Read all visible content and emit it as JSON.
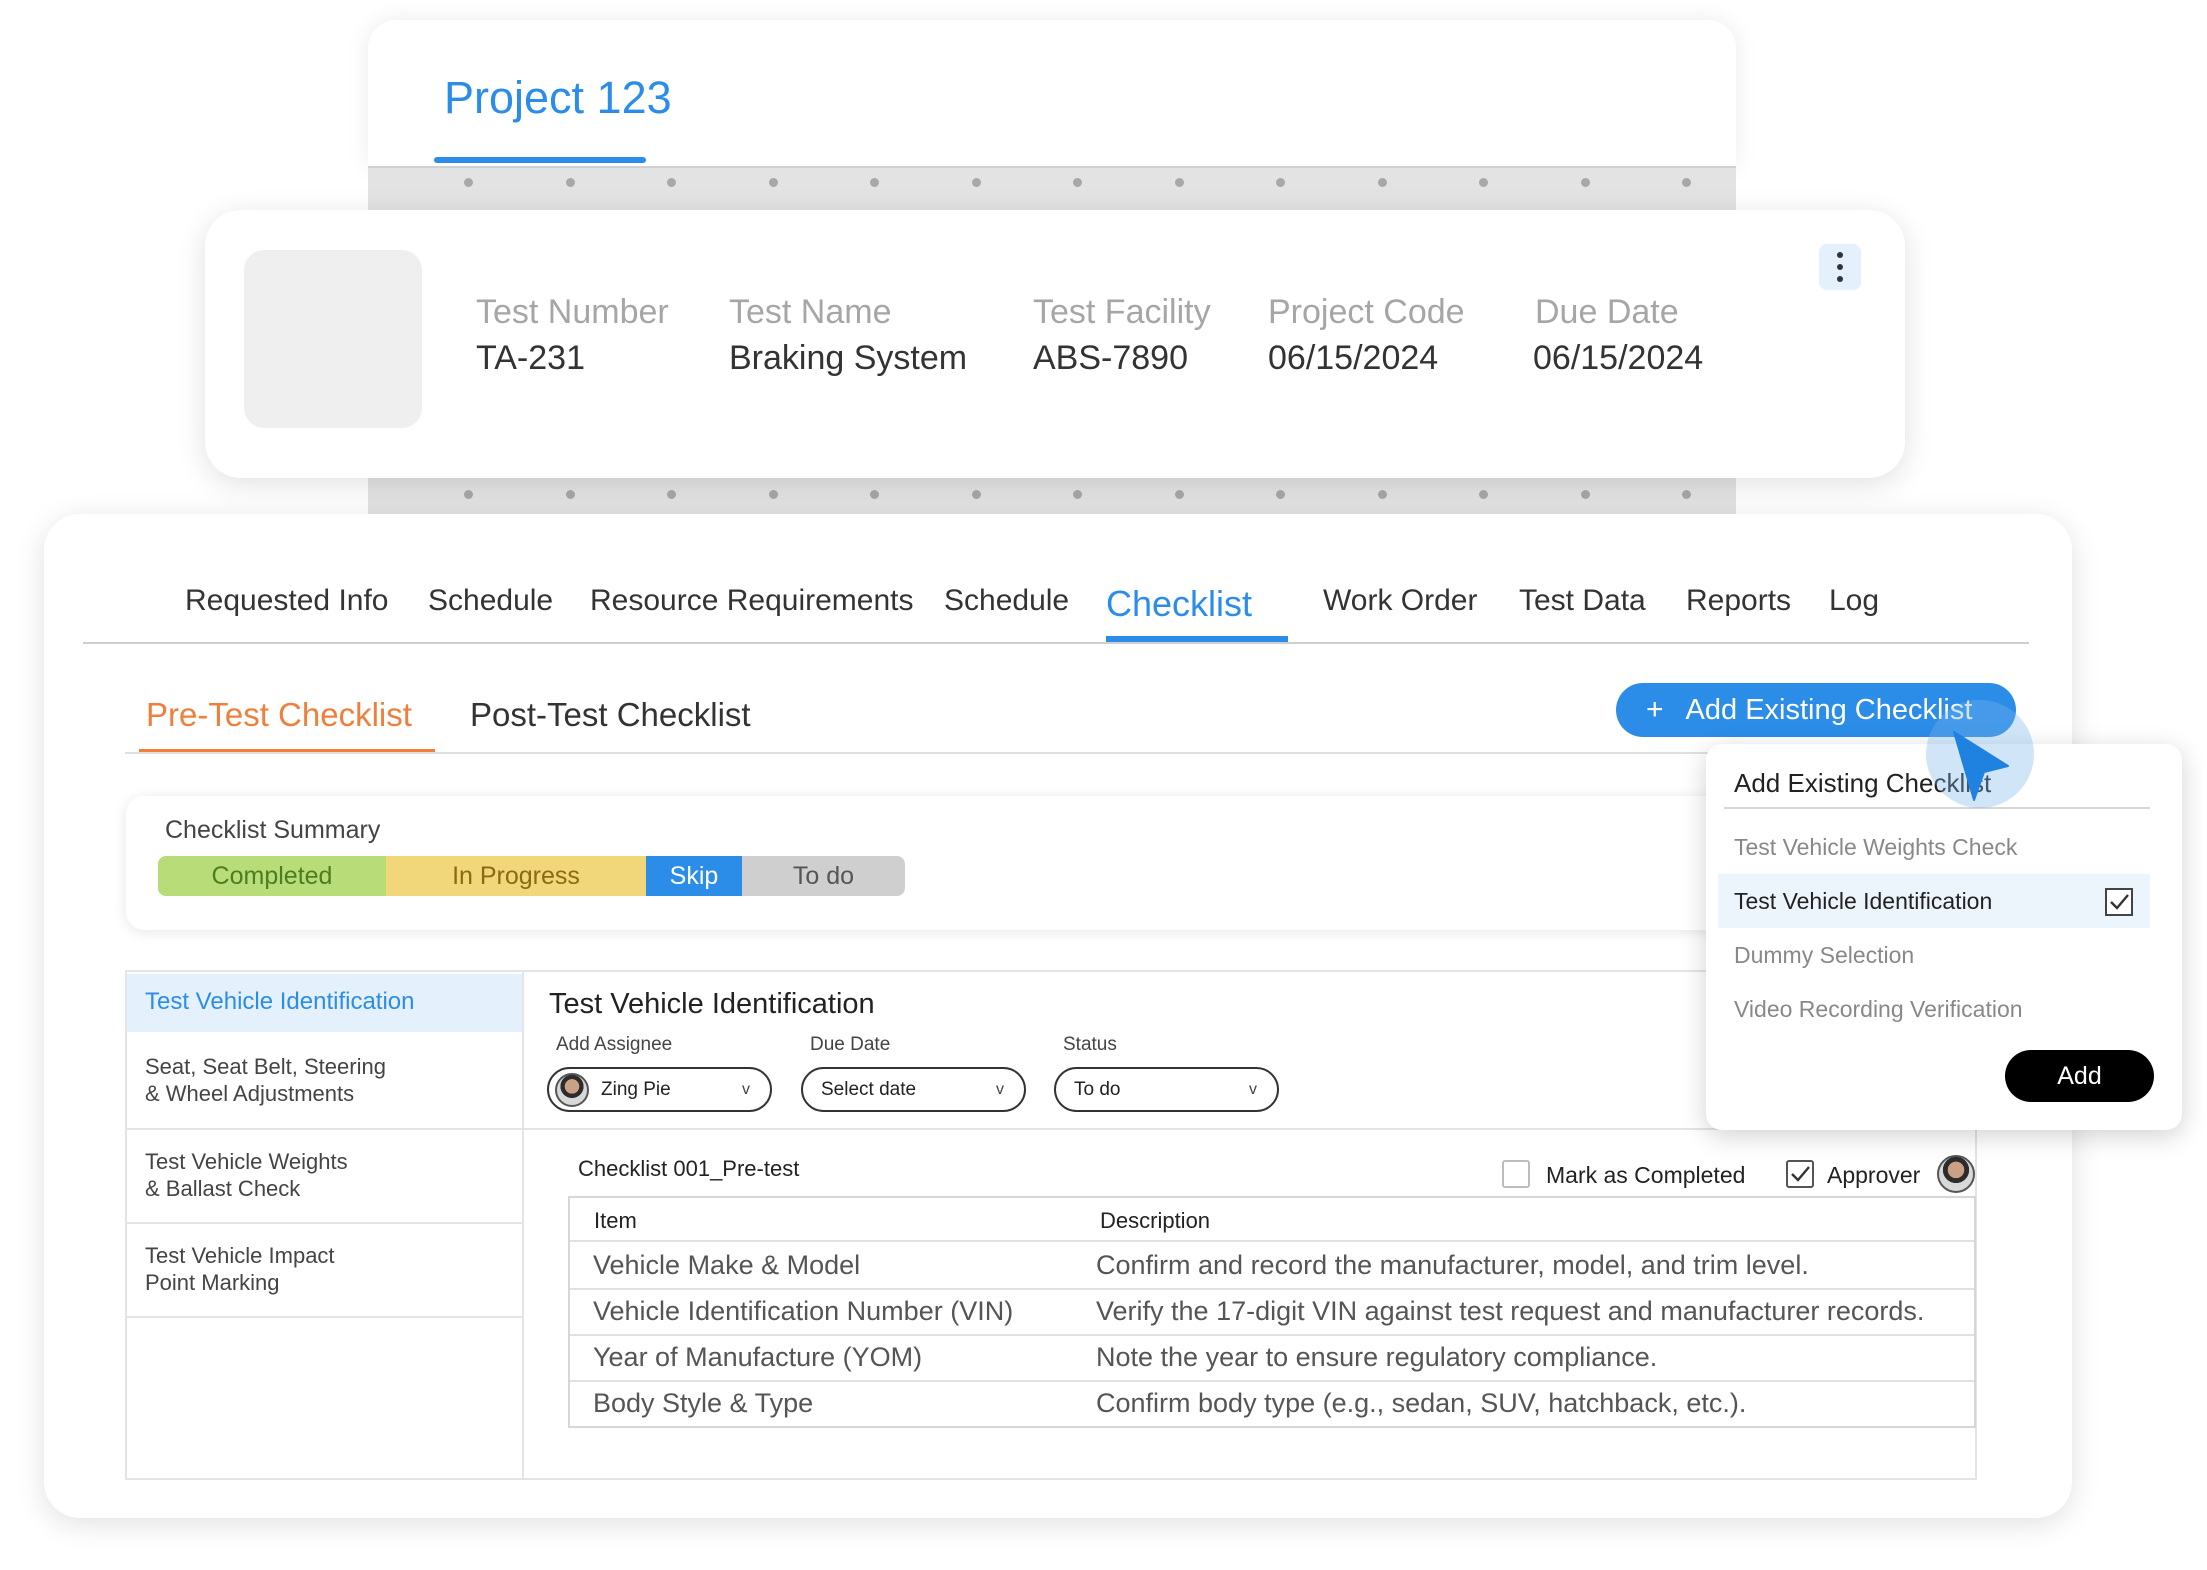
{
  "project": {
    "title": "Project 123"
  },
  "info": {
    "fields": [
      {
        "label": "Test Number",
        "value": "TA-231"
      },
      {
        "label": "Test Name",
        "value": "Braking System"
      },
      {
        "label": "Test Facility",
        "value": "ABS-7890"
      },
      {
        "label": "Project Code",
        "value": "06/15/2024"
      },
      {
        "label": "Due Date",
        "value": "06/15/2024"
      }
    ]
  },
  "tabs": [
    "Requested Info",
    "Schedule",
    "Resource Requirements",
    "Schedule",
    "Checklist",
    "Work Order",
    "Test Data",
    "Reports",
    "Log"
  ],
  "active_tab": "Checklist",
  "subtabs": {
    "pre": "Pre-Test Checklist",
    "post": "Post-Test Checklist",
    "active": "Pre-Test Checklist"
  },
  "add_existing_button": {
    "icon": "+",
    "label": "Add Existing Checklist"
  },
  "summary": {
    "title": "Checklist Summary",
    "segments": [
      {
        "label": "Completed",
        "bg": "#b7dc78",
        "color": "#4e7d20"
      },
      {
        "label": "In Progress",
        "bg": "#f1d77a",
        "color": "#8a6a14"
      },
      {
        "label": "Skip",
        "bg": "#2b8de8",
        "color": "#ffffff"
      },
      {
        "label": "To do",
        "bg": "#cfcfcf",
        "color": "#555555"
      }
    ]
  },
  "sidebar": {
    "items": [
      {
        "line1": "Test Vehicle Identification",
        "line2": ""
      },
      {
        "line1": "Seat, Seat Belt, Steering",
        "line2": "& Wheel Adjustments"
      },
      {
        "line1": "Test Vehicle Weights",
        "line2": "& Ballast Check"
      },
      {
        "line1": "Test Vehicle Impact",
        "line2": "Point Marking"
      }
    ]
  },
  "detail": {
    "title": "Test Vehicle Identification",
    "assignee": {
      "label": "Add Assignee",
      "value": "Zing Pie"
    },
    "due_date": {
      "label": "Due Date",
      "value": "Select date"
    },
    "status": {
      "label": "Status",
      "value": "To do"
    },
    "checklist_name": "Checklist 001_Pre-test",
    "mark_completed": {
      "label": "Mark as Completed",
      "checked": false
    },
    "approver": {
      "label": "Approver",
      "checked": true
    },
    "table": {
      "headers": [
        "Item",
        "Description"
      ],
      "rows": [
        [
          "Vehicle Make & Model",
          "Confirm and record the manufacturer, model, and trim level."
        ],
        [
          "Vehicle Identification Number (VIN)",
          "Verify the 17-digit VIN against test request and manufacturer records."
        ],
        [
          "Year of Manufacture (YOM)",
          "Note the year to ensure regulatory compliance."
        ],
        [
          "Body Style & Type",
          "Confirm body type (e.g., sedan, SUV, hatchback, etc.)."
        ]
      ]
    }
  },
  "dropdown": {
    "title": "Add Existing Checklist",
    "items": [
      {
        "label": "Test Vehicle Weights Check",
        "selected": false
      },
      {
        "label": "Test Vehicle Identification",
        "selected": true
      },
      {
        "label": "Dummy Selection",
        "selected": false
      },
      {
        "label": "Video Recording Verification",
        "selected": false
      }
    ],
    "add_label": "Add",
    "check_glyph": "✓"
  },
  "colors": {
    "accent": "#2b8de8",
    "orange": "#f07f3c"
  },
  "icons": {
    "more": "kebab-menu-icon",
    "check": "checkmark-icon",
    "chevron": "chevron-down-icon",
    "cursor": "pointer-cursor-icon"
  },
  "chevron_glyph": "v"
}
